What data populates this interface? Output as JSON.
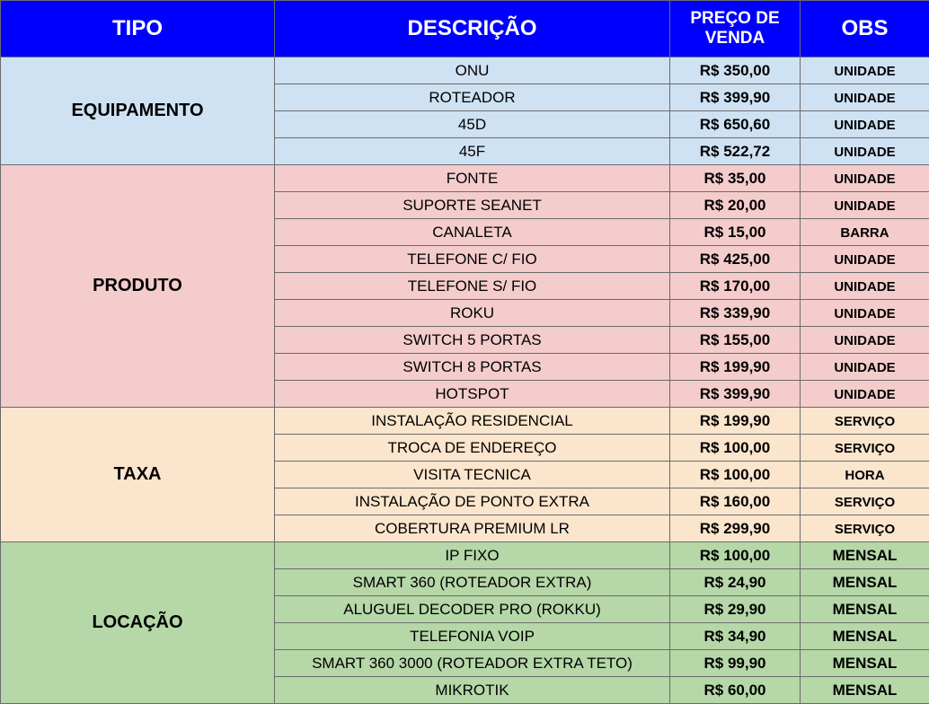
{
  "header": {
    "tipo": "TIPO",
    "descricao": "DESCRIÇÃO",
    "preco_line1": "PREÇO DE",
    "preco_line2": "VENDA",
    "obs": "OBS"
  },
  "groups": [
    {
      "tipo": "EQUIPAMENTO",
      "color": "#cfe2f3",
      "rows": [
        {
          "desc": "ONU",
          "price": "R$ 350,00",
          "obs": "UNIDADE"
        },
        {
          "desc": "ROTEADOR",
          "price": "R$ 399,90",
          "obs": "UNIDADE"
        },
        {
          "desc": "45D",
          "price": "R$ 650,60",
          "obs": "UNIDADE"
        },
        {
          "desc": "45F",
          "price": "R$ 522,72",
          "obs": "UNIDADE"
        }
      ]
    },
    {
      "tipo": "PRODUTO",
      "color": "#f4cccc",
      "rows": [
        {
          "desc": "FONTE",
          "price": "R$ 35,00",
          "obs": "UNIDADE"
        },
        {
          "desc": "SUPORTE SEANET",
          "price": "R$ 20,00",
          "obs": "UNIDADE"
        },
        {
          "desc": "CANALETA",
          "price": "R$ 15,00",
          "obs": "BARRA"
        },
        {
          "desc": "TELEFONE C/ FIO",
          "price": "R$ 425,00",
          "obs": "UNIDADE"
        },
        {
          "desc": "TELEFONE S/ FIO",
          "price": "R$ 170,00",
          "obs": "UNIDADE"
        },
        {
          "desc": "ROKU",
          "price": "R$ 339,90",
          "obs": "UNIDADE"
        },
        {
          "desc": "SWITCH 5 PORTAS",
          "price": "R$ 155,00",
          "obs": "UNIDADE"
        },
        {
          "desc": "SWITCH 8 PORTAS",
          "price": "R$ 199,90",
          "obs": "UNIDADE"
        },
        {
          "desc": "HOTSPOT",
          "price": "R$ 399,90",
          "obs": "UNIDADE"
        }
      ]
    },
    {
      "tipo": "TAXA",
      "color": "#fce5cd",
      "rows": [
        {
          "desc": "INSTALAÇÃO RESIDENCIAL",
          "price": "R$ 199,90",
          "obs": "SERVIÇO"
        },
        {
          "desc": "TROCA DE ENDEREÇO",
          "price": "R$ 100,00",
          "obs": "SERVIÇO"
        },
        {
          "desc": "VISITA TECNICA",
          "price": "R$ 100,00",
          "obs": "HORA"
        },
        {
          "desc": "INSTALAÇÃO DE PONTO EXTRA",
          "price": "R$ 160,00",
          "obs": "SERVIÇO"
        },
        {
          "desc": "COBERTURA PREMIUM LR",
          "price": "R$ 299,90",
          "obs": "SERVIÇO"
        }
      ]
    },
    {
      "tipo": "LOCAÇÃO",
      "color": "#b6d7a8",
      "rows": [
        {
          "desc": "IP FIXO",
          "price": "R$ 100,00",
          "obs": "MENSAL"
        },
        {
          "desc": "SMART 360 (ROTEADOR EXTRA)",
          "price": "R$ 24,90",
          "obs": "MENSAL"
        },
        {
          "desc": "ALUGUEL DECODER PRO (ROKKU)",
          "price": "R$ 29,90",
          "obs": "MENSAL"
        },
        {
          "desc": "TELEFONIA VOIP",
          "price": "R$ 34,90",
          "obs": "MENSAL"
        },
        {
          "desc": "SMART 360 3000 (ROTEADOR EXTRA TETO)",
          "price": "R$ 99,90",
          "obs": "MENSAL"
        },
        {
          "desc": "MIKROTIK",
          "price": "R$ 60,00",
          "obs": "MENSAL"
        }
      ]
    }
  ]
}
